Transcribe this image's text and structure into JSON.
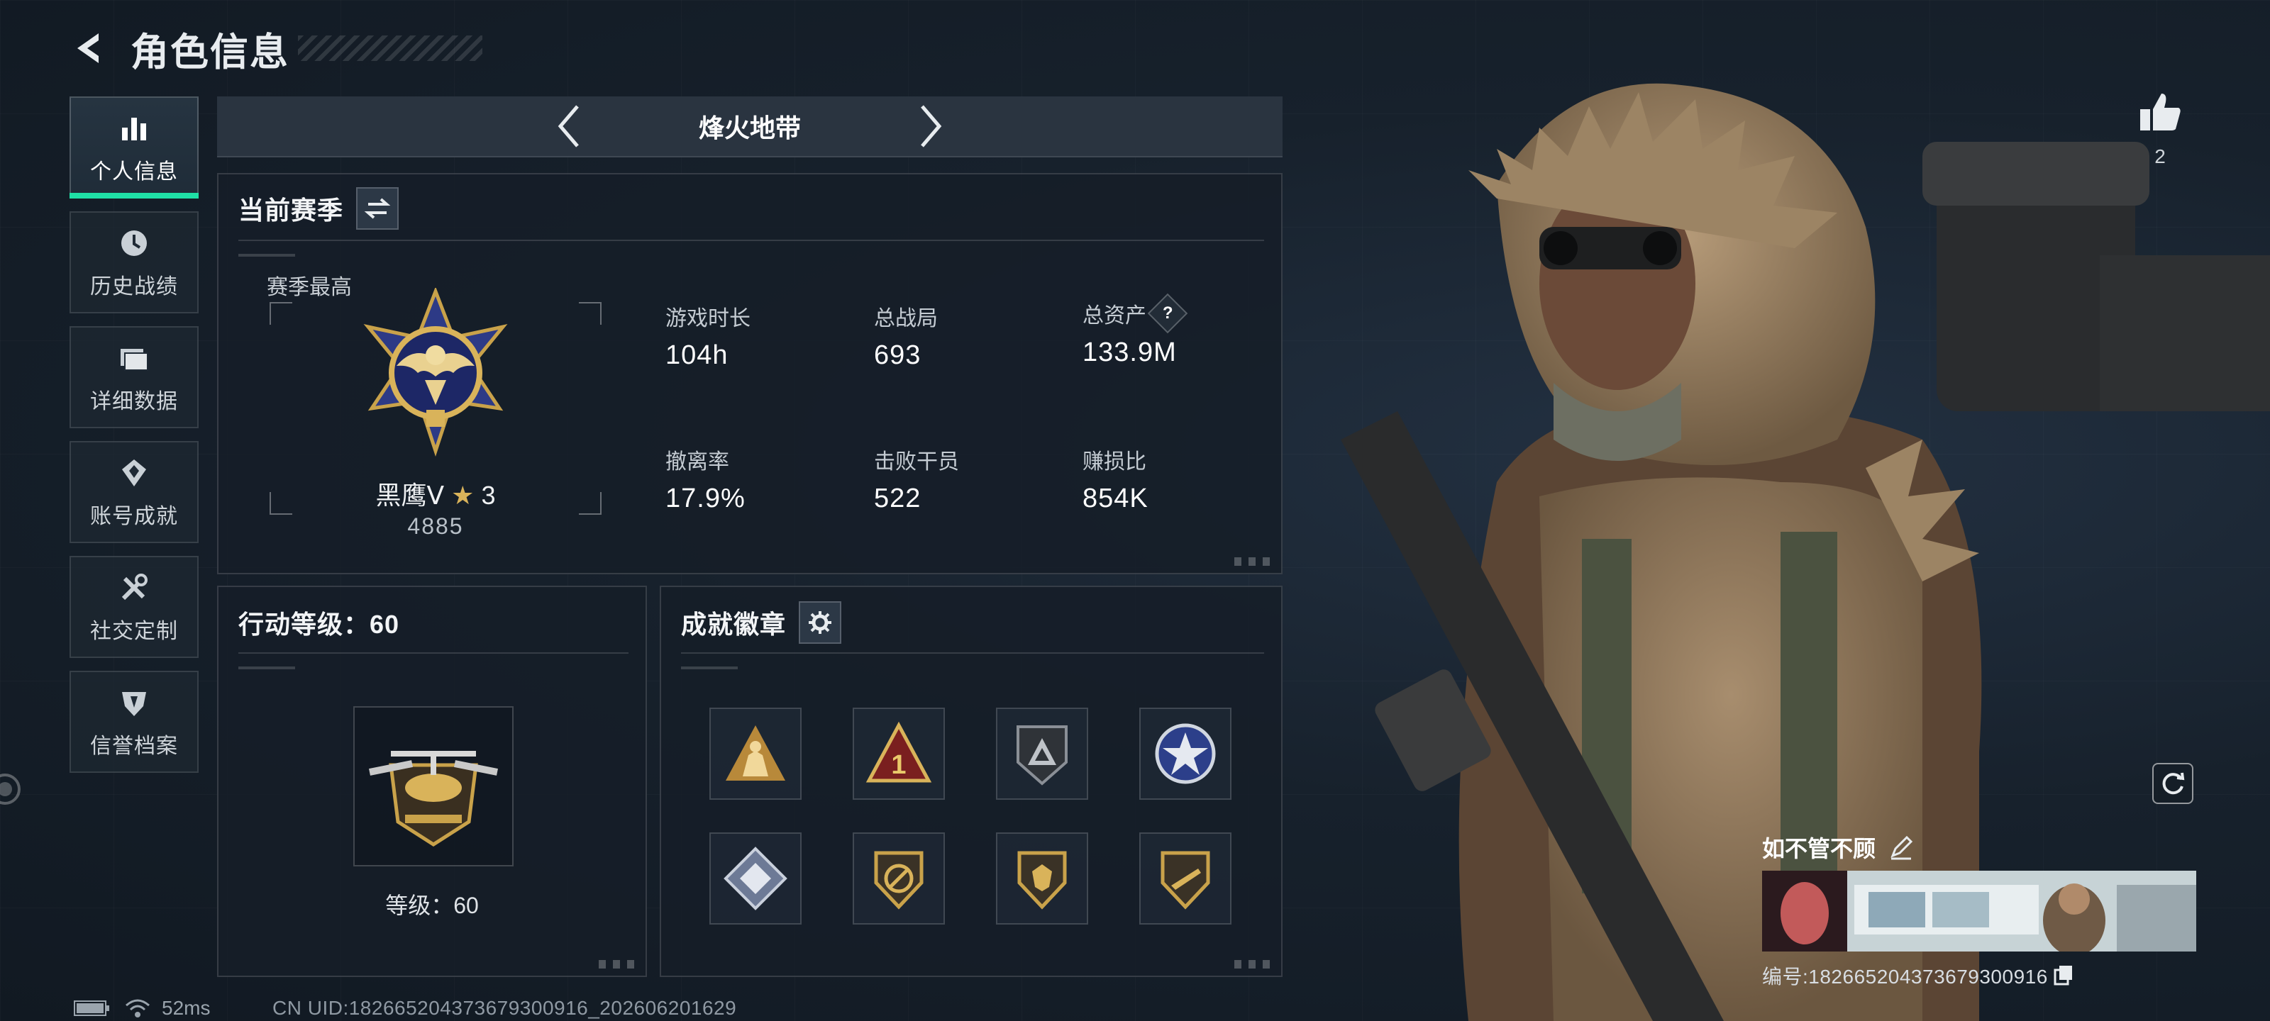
{
  "header": {
    "title": "角色信息"
  },
  "nav": {
    "items": [
      {
        "label": "个人信息",
        "icon": "bar-chart-icon",
        "active": true
      },
      {
        "label": "历史战绩",
        "icon": "clock-icon",
        "active": false
      },
      {
        "label": "详细数据",
        "icon": "folder-icon",
        "active": false
      },
      {
        "label": "账号成就",
        "icon": "achievement-icon",
        "active": false
      },
      {
        "label": "社交定制",
        "icon": "tools-icon",
        "active": false
      },
      {
        "label": "信誉档案",
        "icon": "shield-icon",
        "active": false
      }
    ]
  },
  "mode": {
    "title": "烽火地带"
  },
  "season": {
    "title": "当前赛季",
    "best_label": "赛季最高",
    "rank_name": "黑鹰Ⅴ",
    "rank_stars": "3",
    "rank_score": "4885",
    "stats": [
      {
        "label": "游戏时长",
        "value": "104h"
      },
      {
        "label": "总战局",
        "value": "693"
      },
      {
        "label": "总资产",
        "value": "133.9M",
        "help": "?"
      },
      {
        "label": "撤离率",
        "value": "17.9%"
      },
      {
        "label": "击败干员",
        "value": "522"
      },
      {
        "label": "赚损比",
        "value": "854K"
      }
    ]
  },
  "action_level": {
    "title": "行动等级：60",
    "level_text": "等级：60"
  },
  "badges": {
    "title": "成就徽章",
    "count": 8
  },
  "character": {
    "like_count": "2",
    "card_name": "如不管不顾",
    "card_id": "编号:1826652043736793009​16"
  },
  "status": {
    "ping": "52ms",
    "uid": "CN UID:182665204373679300916_202606201629"
  },
  "colors": {
    "accent": "#1fe0a6",
    "gold": "#c9a24a",
    "panel": "#161e28"
  }
}
